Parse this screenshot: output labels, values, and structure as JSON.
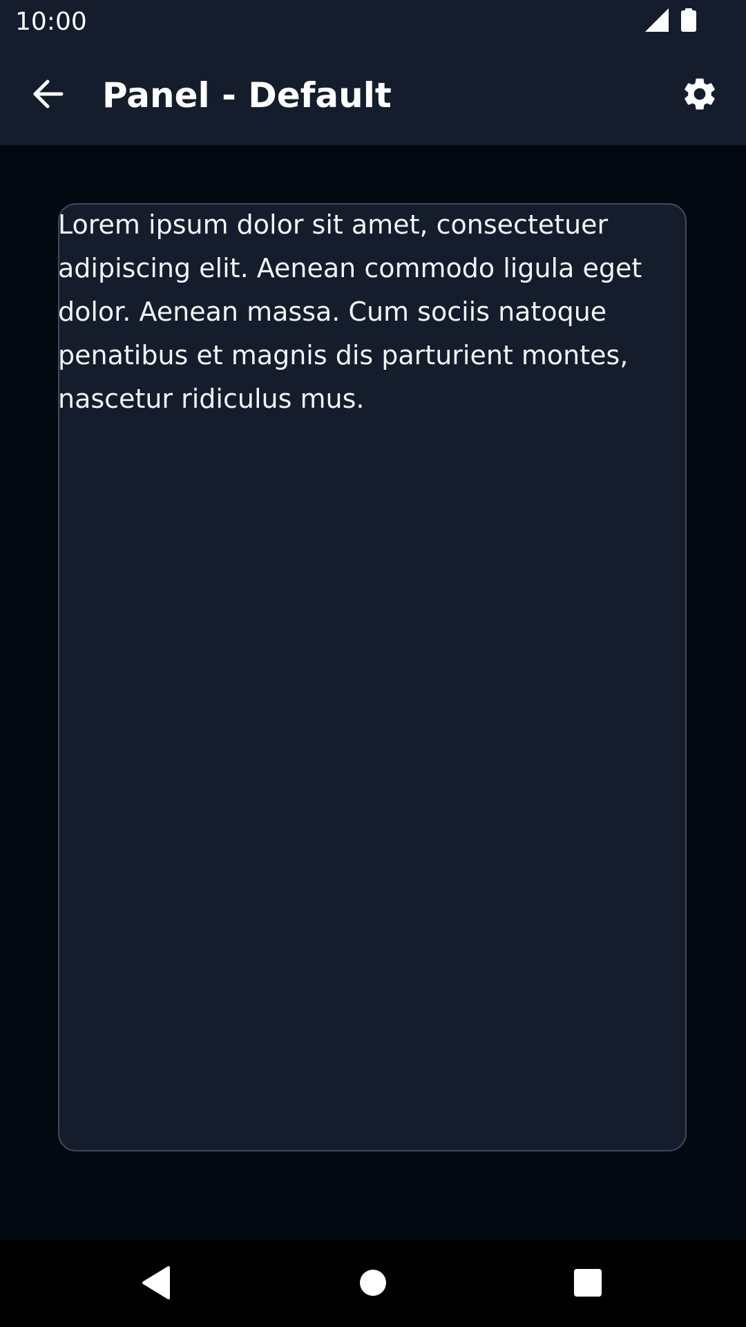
{
  "status_bar": {
    "time": "10:00",
    "icons": [
      "signal-icon",
      "battery-icon"
    ]
  },
  "app_bar": {
    "title": "Panel - Default",
    "back_icon": "back-arrow-icon",
    "settings_icon": "gear-icon"
  },
  "panel": {
    "text": "Lorem ipsum dolor sit amet, consectetuer adipiscing elit. Aenean commodo ligula eget dolor. Aenean massa. Cum sociis natoque penatibus et magnis dis parturient montes, nascetur ridiculus mus."
  },
  "nav_bar": {
    "icons": [
      "back-triangle-icon",
      "home-circle-icon",
      "recents-square-icon"
    ]
  },
  "colors": {
    "background": "#030811",
    "surface": "#151d2c",
    "panel_border": "#434b5a",
    "text": "#ffffff"
  }
}
